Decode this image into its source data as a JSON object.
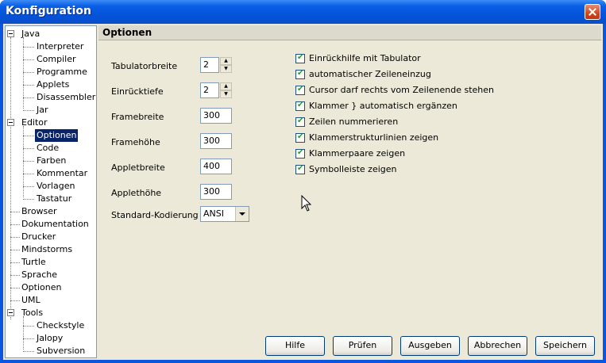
{
  "window": {
    "title": "Konfiguration"
  },
  "tree": [
    {
      "label": "Java",
      "level": 0,
      "expanded": true
    },
    {
      "label": "Interpreter",
      "level": 1
    },
    {
      "label": "Compiler",
      "level": 1
    },
    {
      "label": "Programme",
      "level": 1
    },
    {
      "label": "Applets",
      "level": 1
    },
    {
      "label": "Disassembler",
      "level": 1
    },
    {
      "label": "Jar",
      "level": 1
    },
    {
      "label": "Editor",
      "level": 0,
      "expanded": true
    },
    {
      "label": "Optionen",
      "level": 1,
      "selected": true
    },
    {
      "label": "Code",
      "level": 1
    },
    {
      "label": "Farben",
      "level": 1
    },
    {
      "label": "Kommentar",
      "level": 1
    },
    {
      "label": "Vorlagen",
      "level": 1
    },
    {
      "label": "Tastatur",
      "level": 1
    },
    {
      "label": "Browser",
      "level": 0
    },
    {
      "label": "Dokumentation",
      "level": 0
    },
    {
      "label": "Drucker",
      "level": 0
    },
    {
      "label": "Mindstorms",
      "level": 0
    },
    {
      "label": "Turtle",
      "level": 0
    },
    {
      "label": "Sprache",
      "level": 0
    },
    {
      "label": "Optionen",
      "level": 0
    },
    {
      "label": "UML",
      "level": 0
    },
    {
      "label": "Tools",
      "level": 0,
      "expanded": true
    },
    {
      "label": "Checkstyle",
      "level": 1
    },
    {
      "label": "Jalopy",
      "level": 1
    },
    {
      "label": "Subversion",
      "level": 1
    }
  ],
  "panel": {
    "title": "Optionen",
    "fields": [
      {
        "label": "Tabulatorbreite",
        "value": "2",
        "kind": "spinner"
      },
      {
        "label": "Einrücktiefe",
        "value": "2",
        "kind": "spinner"
      },
      {
        "label": "Framebreite",
        "value": "300",
        "kind": "text"
      },
      {
        "label": "Framehöhe",
        "value": "300",
        "kind": "text"
      },
      {
        "label": "Appletbreite",
        "value": "400",
        "kind": "text"
      },
      {
        "label": "Applethöhe",
        "value": "300",
        "kind": "text"
      }
    ],
    "encoding": {
      "label": "Standard-Kodierung",
      "value": "ANSI"
    },
    "checkboxes": [
      {
        "label": "Einrückhilfe mit Tabulator",
        "checked": true
      },
      {
        "label": "automatischer Zeileneinzug",
        "checked": true
      },
      {
        "label": "Cursor darf rechts vom Zeilenende stehen",
        "checked": true
      },
      {
        "label": "Klammer } automatisch ergänzen",
        "checked": true
      },
      {
        "label": "Zeilen nummerieren",
        "checked": true
      },
      {
        "label": "Klammerstrukturlinien zeigen",
        "checked": true
      },
      {
        "label": "Klammerpaare zeigen",
        "checked": true
      },
      {
        "label": "Symbolleiste zeigen",
        "checked": true
      }
    ]
  },
  "buttons": [
    "Hilfe",
    "Prüfen",
    "Ausgeben",
    "Abbrechen",
    "Speichern"
  ]
}
